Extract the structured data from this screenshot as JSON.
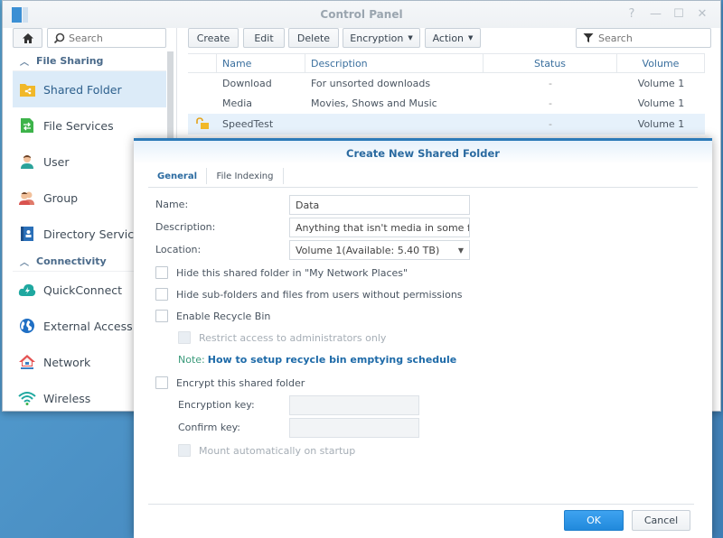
{
  "window": {
    "title": "Control Panel",
    "controls": {
      "help": "?",
      "minimize": "—",
      "maximize": "☐",
      "close": "✕"
    }
  },
  "sidebar": {
    "search_placeholder": "Search",
    "groups": [
      {
        "label": "File Sharing",
        "items": [
          {
            "label": "Shared Folder",
            "icon": "shared-folder-icon",
            "active": true
          },
          {
            "label": "File Services",
            "icon": "file-services-icon"
          },
          {
            "label": "User",
            "icon": "user-icon"
          },
          {
            "label": "Group",
            "icon": "group-icon"
          },
          {
            "label": "Directory Service",
            "icon": "directory-service-icon"
          }
        ]
      },
      {
        "label": "Connectivity",
        "items": [
          {
            "label": "QuickConnect",
            "icon": "quickconnect-icon"
          },
          {
            "label": "External Access",
            "icon": "globe-icon"
          },
          {
            "label": "Network",
            "icon": "network-icon"
          },
          {
            "label": "Wireless",
            "icon": "wifi-icon"
          }
        ]
      }
    ]
  },
  "toolbar": {
    "create": "Create",
    "edit": "Edit",
    "delete": "Delete",
    "encryption": "Encryption",
    "action": "Action",
    "filter_placeholder": "Search"
  },
  "grid": {
    "columns": [
      "Name",
      "Description",
      "Status",
      "Volume"
    ],
    "rows": [
      {
        "name": "Download",
        "description": "For unsorted downloads",
        "status": "-",
        "volume": "Volume 1",
        "icon": ""
      },
      {
        "name": "Media",
        "description": "Movies, Shows and Music",
        "status": "-",
        "volume": "Volume 1",
        "icon": ""
      },
      {
        "name": "SpeedTest",
        "description": "",
        "status": "-",
        "volume": "Volume 1",
        "icon": "unlocked-icon",
        "selected": true
      }
    ]
  },
  "dialog": {
    "title": "Create New Shared Folder",
    "tabs": [
      "General",
      "File Indexing"
    ],
    "name_label": "Name:",
    "name_value": "Data",
    "description_label": "Description:",
    "description_value": "Anything that isn't media in some form",
    "location_label": "Location:",
    "location_value": "Volume 1(Available: 5.40 TB)",
    "hide_network_places": "Hide this shared folder in \"My Network Places\"",
    "hide_subfolders": "Hide sub-folders and files from users without permissions",
    "enable_recycle_bin": "Enable Recycle Bin",
    "restrict_admins": "Restrict access to administrators only",
    "note_label": "Note:",
    "note_link": "How to setup recycle bin emptying schedule",
    "encrypt_folder": "Encrypt this shared folder",
    "encryption_key_label": "Encryption key:",
    "confirm_key_label": "Confirm key:",
    "mount_auto": "Mount automatically on startup",
    "ok": "OK",
    "cancel": "Cancel"
  },
  "colors": {
    "accent": "#2c7ab8",
    "ok_button": "#2189dc",
    "selected_row": "#e6f1fb",
    "active_sidebar": "#dcebf8"
  }
}
